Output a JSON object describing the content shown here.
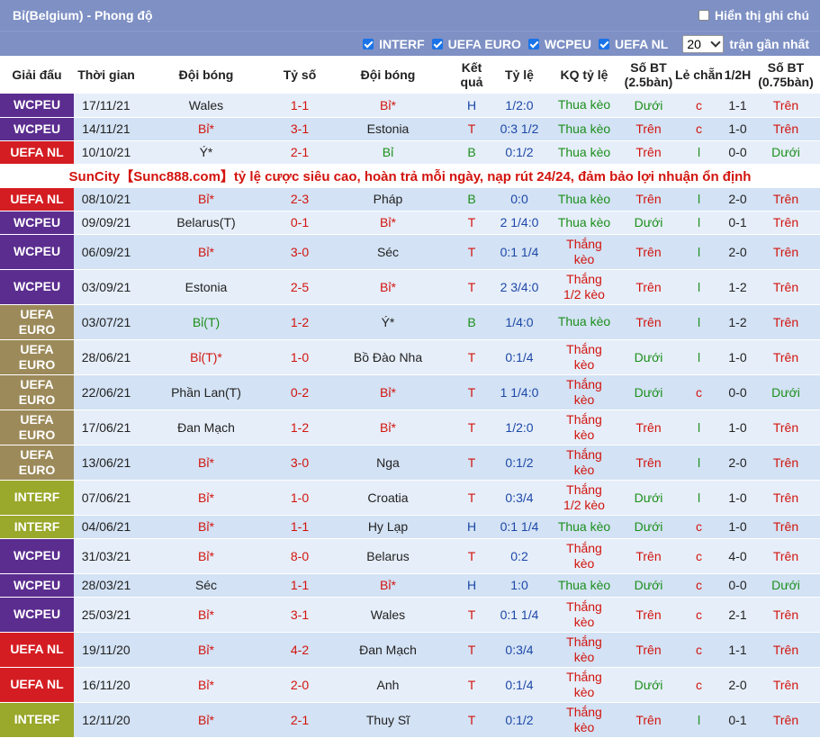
{
  "header": {
    "title": "Bỉ(Belgium) - Phong độ",
    "show_notes_label": "Hiển thị ghi chú"
  },
  "filters": {
    "items": [
      {
        "label": "INTERF",
        "checked": true
      },
      {
        "label": "UEFA EURO",
        "checked": true
      },
      {
        "label": "WCPEU",
        "checked": true
      },
      {
        "label": "UEFA NL",
        "checked": true
      }
    ],
    "count_value": "20",
    "count_suffix": "trận gần nhất"
  },
  "columns": [
    "Giải đấu",
    "Thời gian",
    "Đội bóng",
    "Tỷ số",
    "Đội bóng",
    "Kết quả",
    "Tỷ lệ",
    "KQ tỷ lệ",
    "Số BT (2.5bàn)",
    "Lẻ chẵn",
    "1/2H",
    "Số BT (0.75bàn)"
  ],
  "comp_colors": {
    "WCPEU": "#5b2d8f",
    "UEFA NL": "#d41d22",
    "UEFA EURO": "#9c8a5a",
    "INTERF": "#9aa82b"
  },
  "ad_text": "SunCity【Sunc888.com】tỷ lệ cược siêu cao, hoàn trả mỗi ngày, nạp rút 24/24, đảm bảo lợi nhuận ổn định",
  "rows": [
    {
      "comp": "WCPEU",
      "date": "17/11/21",
      "home": "Wales",
      "score": "1-1",
      "away": "Bỉ*",
      "res": "H",
      "odds": "1/2:0",
      "kq": "Thua kèo",
      "bt": "Dưới",
      "lc": "c",
      "h1": "1-1",
      "bt2": "Trên"
    },
    {
      "comp": "WCPEU",
      "date": "14/11/21",
      "home": "Bỉ*",
      "score": "3-1",
      "away": "Estonia",
      "res": "T",
      "odds": "0:3 1/2",
      "kq": "Thua kèo",
      "bt": "Trên",
      "lc": "c",
      "h1": "1-0",
      "bt2": "Trên"
    },
    {
      "comp": "UEFA NL",
      "date": "10/10/21",
      "home": "Ý*",
      "score": "2-1",
      "away": "Bỉ",
      "res": "B",
      "odds": "0:1/2",
      "kq": "Thua kèo",
      "bt": "Trên",
      "lc": "l",
      "h1": "0-0",
      "bt2": "Dưới"
    },
    {
      "comp": "UEFA NL",
      "date": "08/10/21",
      "home": "Bỉ*",
      "score": "2-3",
      "away": "Pháp",
      "res": "B",
      "odds": "0:0",
      "kq": "Thua kèo",
      "bt": "Trên",
      "lc": "l",
      "h1": "2-0",
      "bt2": "Trên"
    },
    {
      "comp": "WCPEU",
      "date": "09/09/21",
      "home": "Belarus(T)",
      "score": "0-1",
      "away": "Bỉ*",
      "res": "T",
      "odds": "2 1/4:0",
      "kq": "Thua kèo",
      "bt": "Dưới",
      "lc": "l",
      "h1": "0-1",
      "bt2": "Trên"
    },
    {
      "comp": "WCPEU",
      "date": "06/09/21",
      "home": "Bỉ*",
      "score": "3-0",
      "away": "Séc",
      "res": "T",
      "odds": "0:1 1/4",
      "kq": "Thắng kèo",
      "bt": "Trên",
      "lc": "l",
      "h1": "2-0",
      "bt2": "Trên"
    },
    {
      "comp": "WCPEU",
      "date": "03/09/21",
      "home": "Estonia",
      "score": "2-5",
      "away": "Bỉ*",
      "res": "T",
      "odds": "2 3/4:0",
      "kq": "Thắng 1/2 kèo",
      "bt": "Trên",
      "lc": "l",
      "h1": "1-2",
      "bt2": "Trên"
    },
    {
      "comp": "UEFA EURO",
      "date": "03/07/21",
      "home": "Bỉ(T)",
      "score": "1-2",
      "away": "Ý*",
      "res": "B",
      "odds": "1/4:0",
      "kq": "Thua kèo",
      "bt": "Trên",
      "lc": "l",
      "h1": "1-2",
      "bt2": "Trên"
    },
    {
      "comp": "UEFA EURO",
      "date": "28/06/21",
      "home": "Bỉ(T)*",
      "score": "1-0",
      "away": "Bồ Đào Nha",
      "res": "T",
      "odds": "0:1/4",
      "kq": "Thắng kèo",
      "bt": "Dưới",
      "lc": "l",
      "h1": "1-0",
      "bt2": "Trên"
    },
    {
      "comp": "UEFA EURO",
      "date": "22/06/21",
      "home": "Phần Lan(T)",
      "score": "0-2",
      "away": "Bỉ*",
      "res": "T",
      "odds": "1 1/4:0",
      "kq": "Thắng kèo",
      "bt": "Dưới",
      "lc": "c",
      "h1": "0-0",
      "bt2": "Dưới"
    },
    {
      "comp": "UEFA EURO",
      "date": "17/06/21",
      "home": "Đan Mạch",
      "score": "1-2",
      "away": "Bỉ*",
      "res": "T",
      "odds": "1/2:0",
      "kq": "Thắng kèo",
      "bt": "Trên",
      "lc": "l",
      "h1": "1-0",
      "bt2": "Trên"
    },
    {
      "comp": "UEFA EURO",
      "date": "13/06/21",
      "home": "Bỉ*",
      "score": "3-0",
      "away": "Nga",
      "res": "T",
      "odds": "0:1/2",
      "kq": "Thắng kèo",
      "bt": "Trên",
      "lc": "l",
      "h1": "2-0",
      "bt2": "Trên"
    },
    {
      "comp": "INTERF",
      "date": "07/06/21",
      "home": "Bỉ*",
      "score": "1-0",
      "away": "Croatia",
      "res": "T",
      "odds": "0:3/4",
      "kq": "Thắng 1/2 kèo",
      "bt": "Dưới",
      "lc": "l",
      "h1": "1-0",
      "bt2": "Trên"
    },
    {
      "comp": "INTERF",
      "date": "04/06/21",
      "home": "Bỉ*",
      "score": "1-1",
      "away": "Hy Lạp",
      "res": "H",
      "odds": "0:1 1/4",
      "kq": "Thua kèo",
      "bt": "Dưới",
      "lc": "c",
      "h1": "1-0",
      "bt2": "Trên"
    },
    {
      "comp": "WCPEU",
      "date": "31/03/21",
      "home": "Bỉ*",
      "score": "8-0",
      "away": "Belarus",
      "res": "T",
      "odds": "0:2",
      "kq": "Thắng kèo",
      "bt": "Trên",
      "lc": "c",
      "h1": "4-0",
      "bt2": "Trên"
    },
    {
      "comp": "WCPEU",
      "date": "28/03/21",
      "home": "Séc",
      "score": "1-1",
      "away": "Bỉ*",
      "res": "H",
      "odds": "1:0",
      "kq": "Thua kèo",
      "bt": "Dưới",
      "lc": "c",
      "h1": "0-0",
      "bt2": "Dưới"
    },
    {
      "comp": "WCPEU",
      "date": "25/03/21",
      "home": "Bỉ*",
      "score": "3-1",
      "away": "Wales",
      "res": "T",
      "odds": "0:1 1/4",
      "kq": "Thắng kèo",
      "bt": "Trên",
      "lc": "c",
      "h1": "2-1",
      "bt2": "Trên"
    },
    {
      "comp": "UEFA NL",
      "date": "19/11/20",
      "home": "Bỉ*",
      "score": "4-2",
      "away": "Đan Mạch",
      "res": "T",
      "odds": "0:3/4",
      "kq": "Thắng kèo",
      "bt": "Trên",
      "lc": "c",
      "h1": "1-1",
      "bt2": "Trên"
    },
    {
      "comp": "UEFA NL",
      "date": "16/11/20",
      "home": "Bỉ*",
      "score": "2-0",
      "away": "Anh",
      "res": "T",
      "odds": "0:1/4",
      "kq": "Thắng kèo",
      "bt": "Dưới",
      "lc": "c",
      "h1": "2-0",
      "bt2": "Trên"
    },
    {
      "comp": "INTERF",
      "date": "12/11/20",
      "home": "Bỉ*",
      "score": "2-1",
      "away": "Thuy Sĩ",
      "res": "T",
      "odds": "0:1/2",
      "kq": "Thắng kèo",
      "bt": "Trên",
      "lc": "l",
      "h1": "0-1",
      "bt2": "Trên"
    }
  ]
}
